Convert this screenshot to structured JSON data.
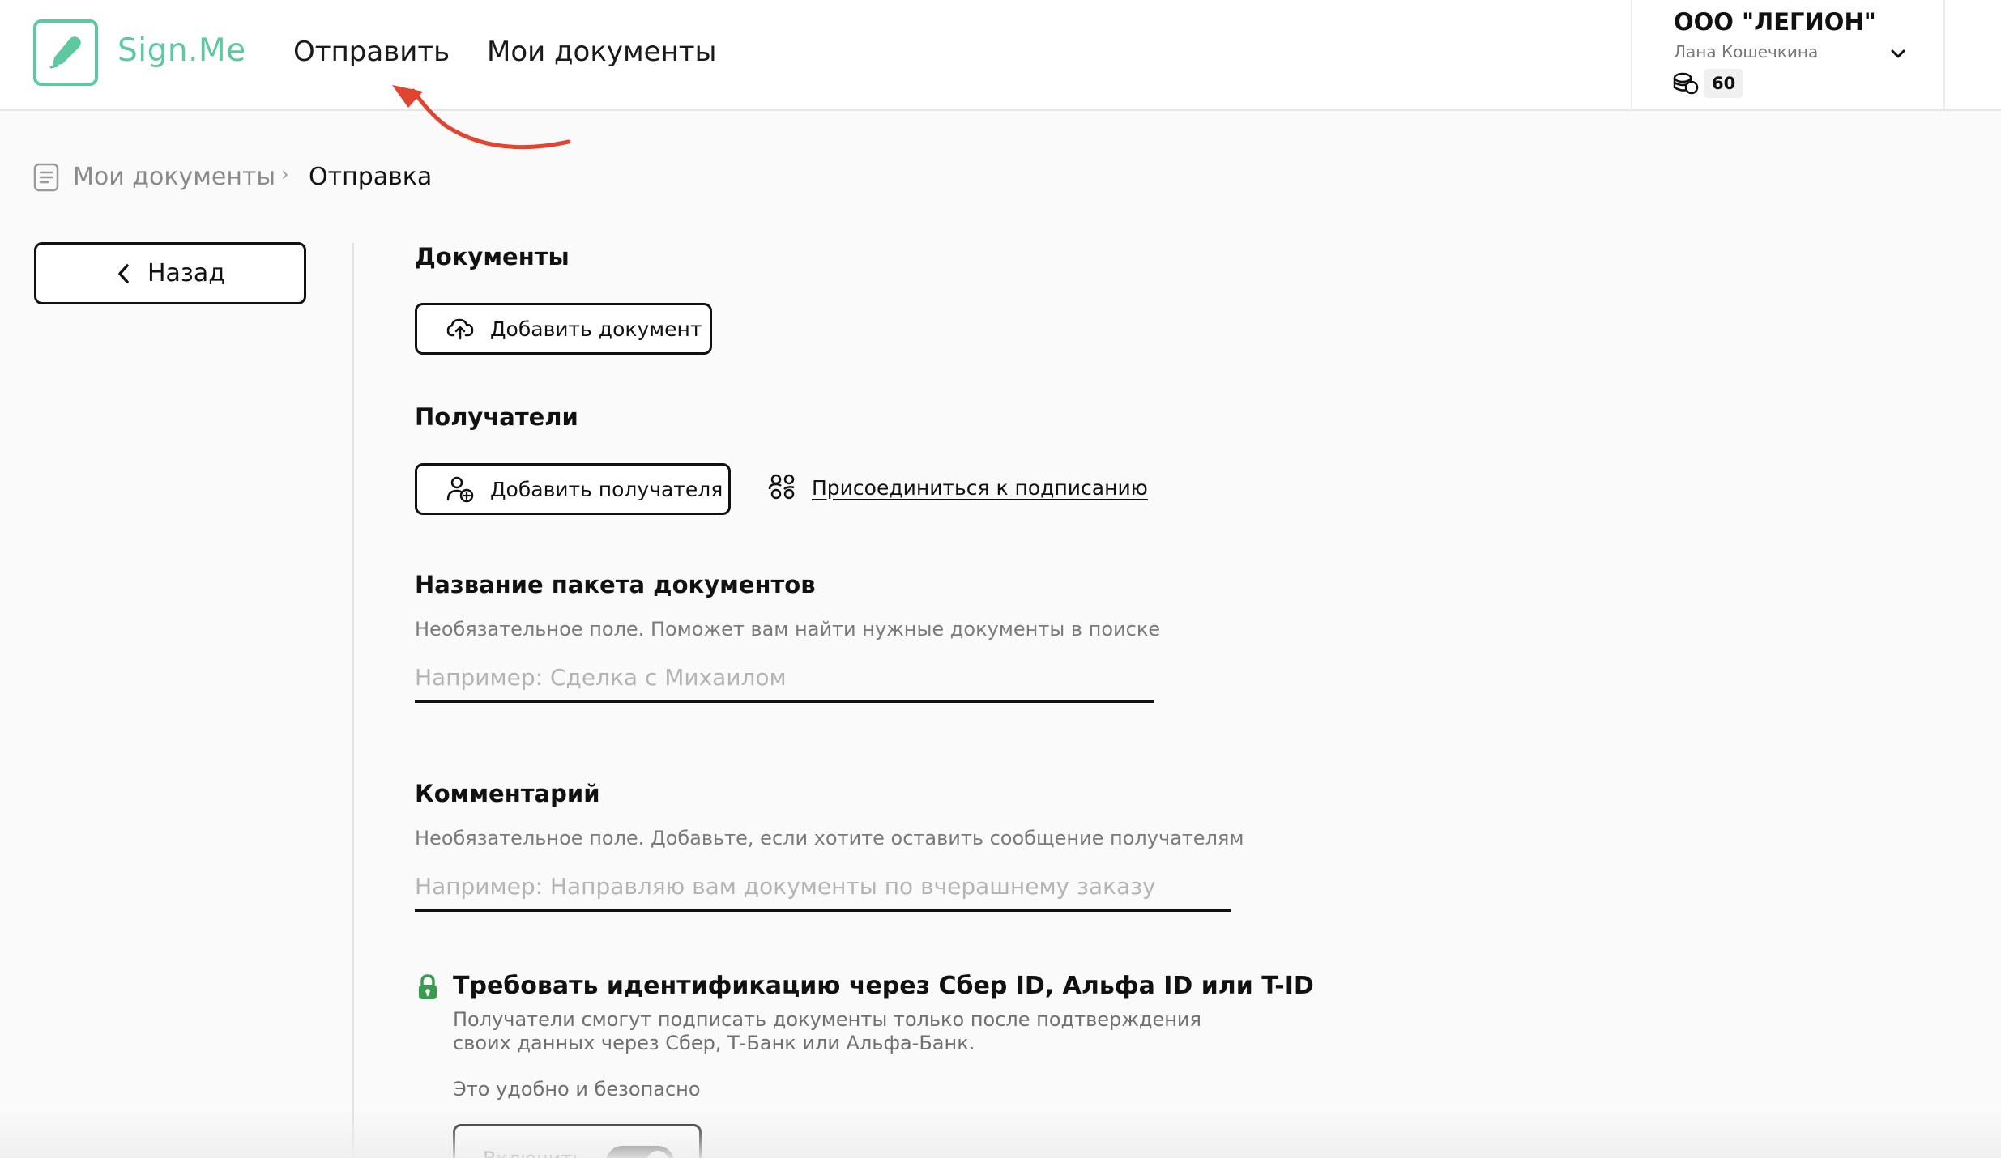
{
  "header": {
    "logo_text": "Sign.Me",
    "nav": {
      "send": "Отправить",
      "my_docs": "Мои документы"
    },
    "account": {
      "org": "ООО \"ЛЕГИОН\"",
      "user": "Лана Кошечкина",
      "balance": "60"
    }
  },
  "breadcrumb": {
    "parent": "Мои документы",
    "separator": "›",
    "current": "Отправка"
  },
  "back_label": "Назад",
  "documents": {
    "title": "Документы",
    "add_button": "Добавить документ"
  },
  "recipients": {
    "title": "Получатели",
    "add_button": "Добавить получателя",
    "join_link": "Присоединиться к подписанию"
  },
  "package_name": {
    "title": "Название пакета документов",
    "hint": "Необязательное поле. Поможет вам найти нужные документы в поиске",
    "placeholder": "Например: Сделка с Михаилом"
  },
  "comment": {
    "title": "Комментарий",
    "hint": "Необязательное поле. Добавьте, если хотите оставить сообщение получателям",
    "placeholder": "Например: Направляю вам документы по вчерашнему заказу"
  },
  "identification": {
    "title": "Требовать идентификацию через Сбер ID, Альфа ID или T-ID",
    "description": "Получатели смогут подписать документы только после подтверждения своих данных через Сбер, Т-Банк или Альфа-Банк.",
    "note": "Это удобно и безопасно",
    "toggle_label": "Включить",
    "toggle_on": true
  },
  "colors": {
    "brand": "#5ec8a0",
    "annotation_arrow": "#e2452f",
    "lock": "#3a9b4e"
  }
}
